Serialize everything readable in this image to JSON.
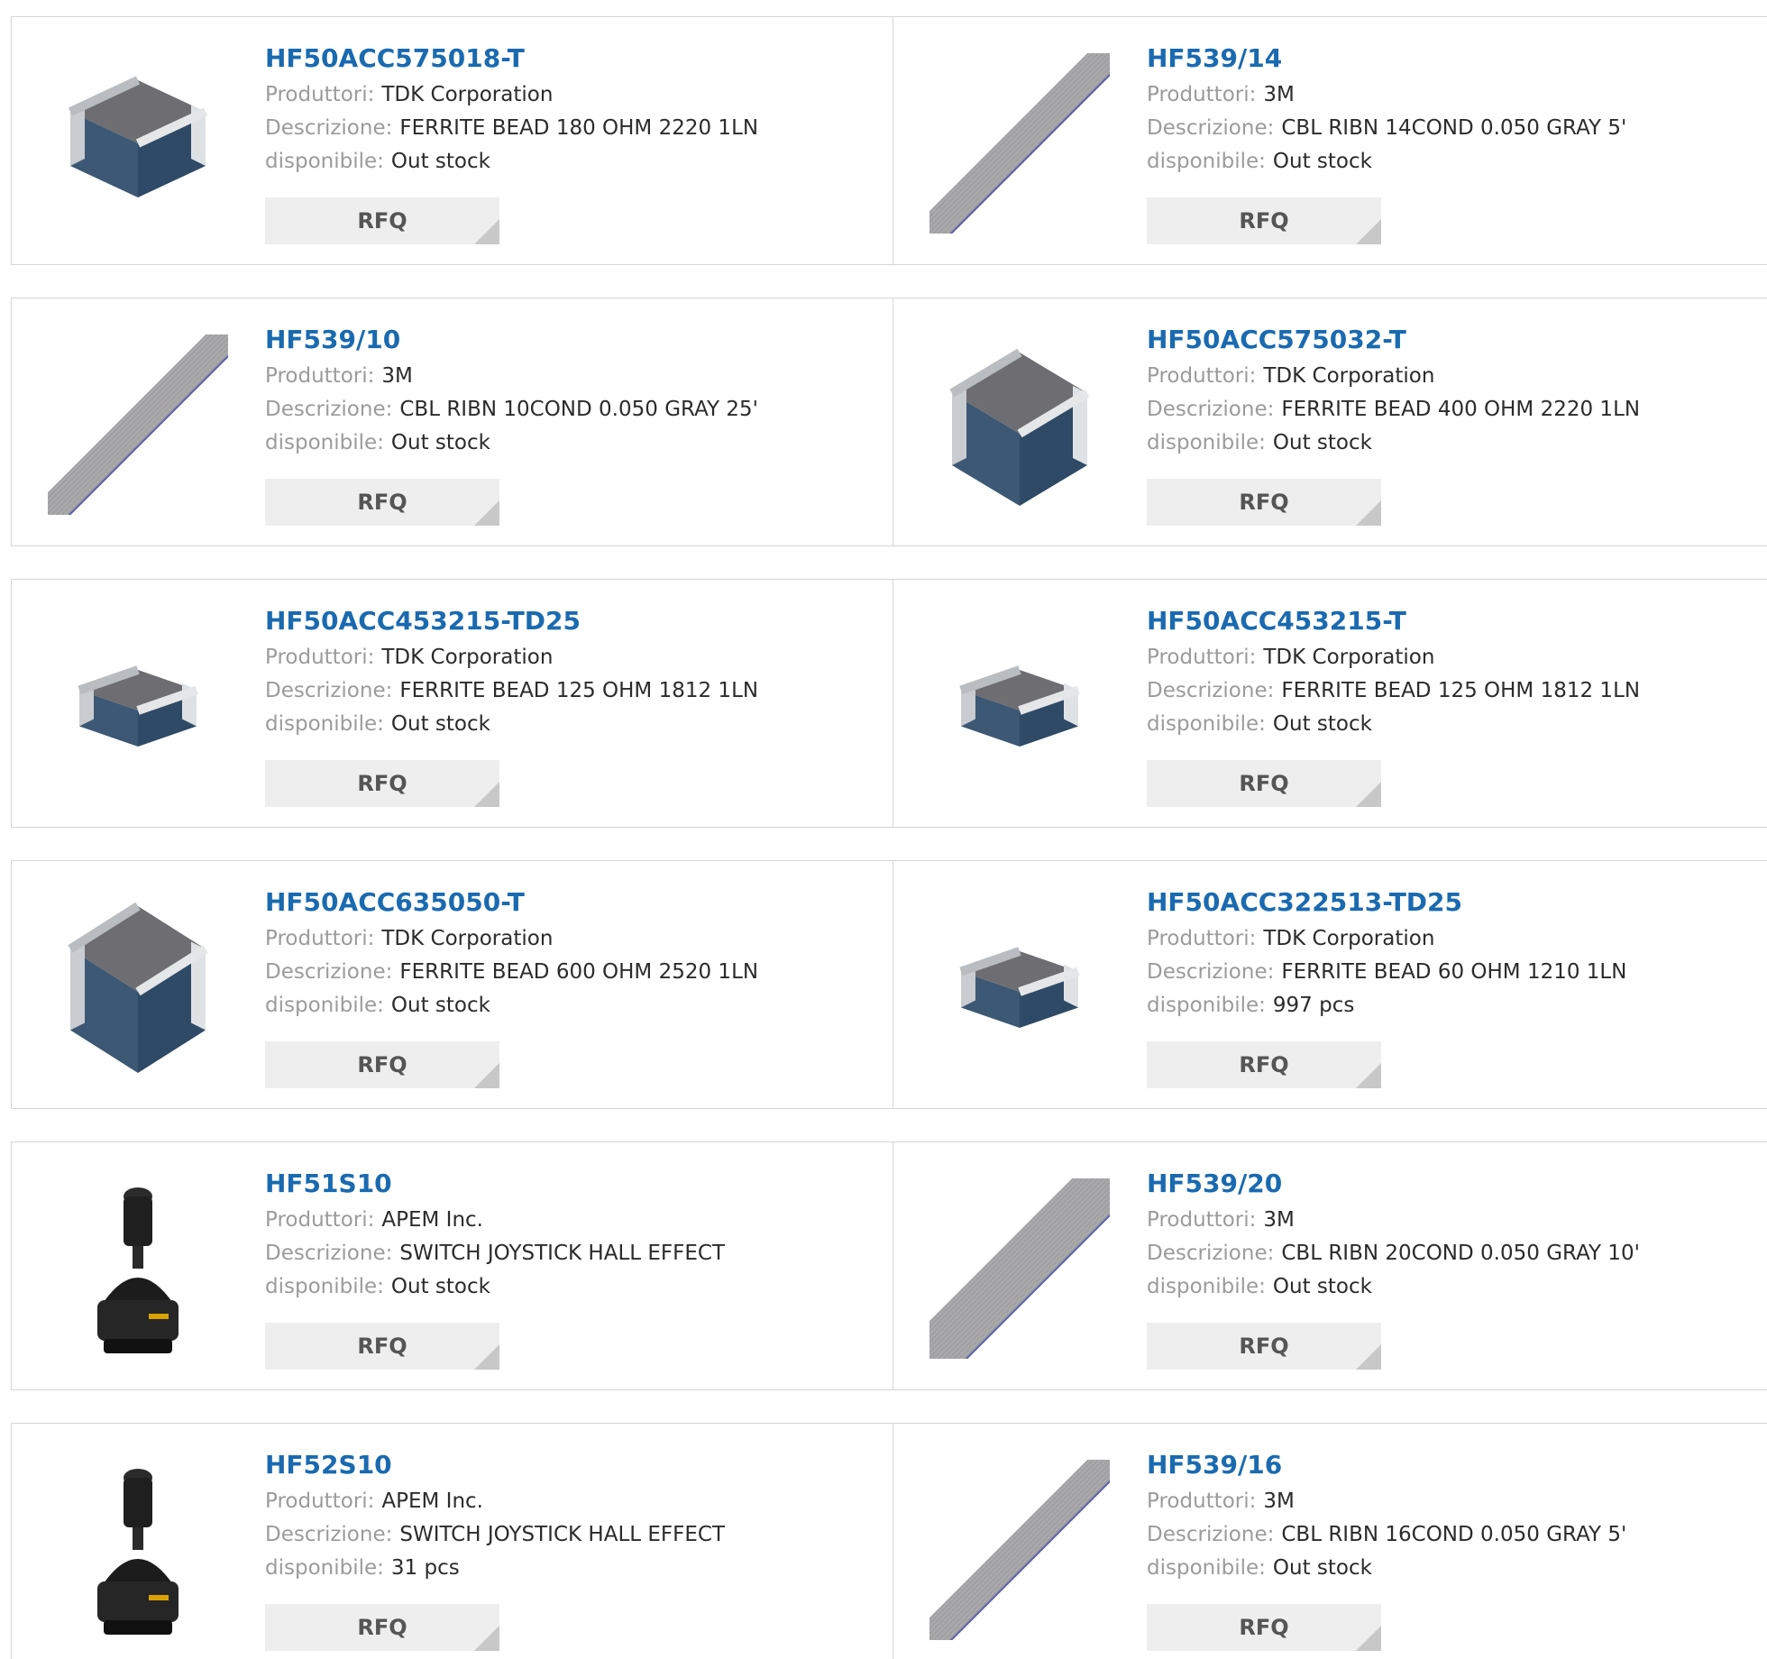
{
  "labels": {
    "manufacturer": "Produttori:",
    "description": "Descrizione:",
    "availability": "disponibile:",
    "rfq": "RFQ"
  },
  "colors": {
    "link": "#1a6ab0",
    "label": "#9b9b9b",
    "value": "#2b2b2b",
    "border": "#d6d6d6",
    "button_bg": "#eeeeee"
  },
  "products": [
    {
      "part": "HF50ACC575018-T",
      "manufacturer": "TDK Corporation",
      "description": "FERRITE BEAD 180 OHM 2220 1LN",
      "availability": "Out stock",
      "image": "chip-ferrite-bead-icon"
    },
    {
      "part": "HF539/14",
      "manufacturer": "3M",
      "description": "CBL RIBN 14COND 0.050 GRAY 5'",
      "availability": "Out stock",
      "image": "ribbon-cable-icon"
    },
    {
      "part": "HF539/10",
      "manufacturer": "3M",
      "description": "CBL RIBN 10COND 0.050 GRAY 25'",
      "availability": "Out stock",
      "image": "ribbon-cable-icon"
    },
    {
      "part": "HF50ACC575032-T",
      "manufacturer": "TDK Corporation",
      "description": "FERRITE BEAD 400 OHM 2220 1LN",
      "availability": "Out stock",
      "image": "chip-ferrite-bead-icon"
    },
    {
      "part": "HF50ACC453215-TD25",
      "manufacturer": "TDK Corporation",
      "description": "FERRITE BEAD 125 OHM 1812 1LN",
      "availability": "Out stock",
      "image": "chip-ferrite-bead-icon"
    },
    {
      "part": "HF50ACC453215-T",
      "manufacturer": "TDK Corporation",
      "description": "FERRITE BEAD 125 OHM 1812 1LN",
      "availability": "Out stock",
      "image": "chip-ferrite-bead-icon"
    },
    {
      "part": "HF50ACC635050-T",
      "manufacturer": "TDK Corporation",
      "description": "FERRITE BEAD 600 OHM 2520 1LN",
      "availability": "Out stock",
      "image": "chip-ferrite-bead-icon"
    },
    {
      "part": "HF50ACC322513-TD25",
      "manufacturer": "TDK Corporation",
      "description": "FERRITE BEAD 60 OHM 1210 1LN",
      "availability": "997 pcs",
      "image": "chip-ferrite-bead-icon"
    },
    {
      "part": "HF51S10",
      "manufacturer": "APEM Inc.",
      "description": "SWITCH JOYSTICK HALL EFFECT",
      "availability": "Out stock",
      "image": "joystick-icon"
    },
    {
      "part": "HF539/20",
      "manufacturer": "3M",
      "description": "CBL RIBN 20COND 0.050 GRAY 10'",
      "availability": "Out stock",
      "image": "ribbon-cable-icon"
    },
    {
      "part": "HF52S10",
      "manufacturer": "APEM Inc.",
      "description": "SWITCH JOYSTICK HALL EFFECT",
      "availability": "31 pcs",
      "image": "joystick-icon"
    },
    {
      "part": "HF539/16",
      "manufacturer": "3M",
      "description": "CBL RIBN 16COND 0.050 GRAY 5'",
      "availability": "Out stock",
      "image": "ribbon-cable-icon"
    }
  ]
}
